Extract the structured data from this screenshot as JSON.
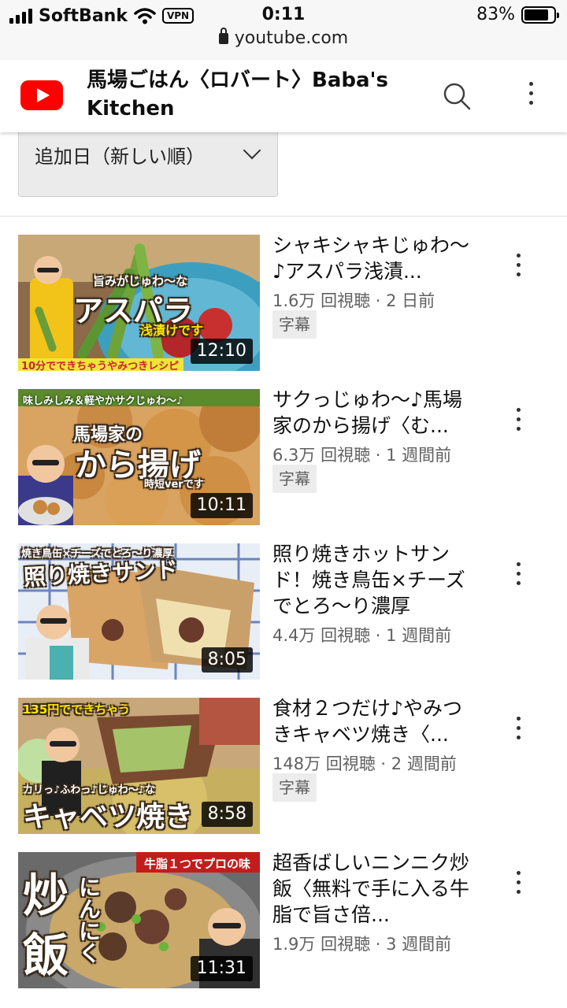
{
  "status_bar": {
    "carrier": "SoftBank",
    "vpn": "VPN",
    "time": "0:11",
    "battery": "83%",
    "battery_level": 0.83,
    "url": "youtube.com"
  },
  "header": {
    "channel_title": "馬場ごはん〈ロバート〉Baba's Kitchen",
    "logo_icon": "youtube-logo-icon",
    "search_icon": "search-icon",
    "menu_icon": "more-vert-icon"
  },
  "sort": {
    "label": "追加日（新しい順）"
  },
  "videos": [
    {
      "title": "シャキシャキじゅわ〜♪アスパラ浅漬...",
      "meta": "1.6万 回視聴 · 2 日前",
      "caption": "字幕",
      "duration": "12:10",
      "thumb": {
        "top": "旨みがじゅわ〜な",
        "main": "アスパラ",
        "sub": "浅漬けです",
        "bottom": "10分でできちゃうやみつきレシピ"
      }
    },
    {
      "title": "サクっじゅわ〜♪馬場家のから揚げ〈む...",
      "meta": "6.3万 回視聴 · 1 週間前",
      "caption": "字幕",
      "duration": "10:11",
      "thumb": {
        "top": "味しみしみ＆軽やかサクじゅわ〜♪",
        "main1": "馬場家の",
        "main2": "から揚げ",
        "sub": "時短verです"
      }
    },
    {
      "title": "照り焼きホットサンド！焼き鳥缶×チーズでとろ〜り濃厚",
      "meta": "4.4万 回視聴 · 1 週間前",
      "caption": "",
      "duration": "8:05",
      "thumb": {
        "top": "焼き鳥缶×チーズでとろ〜り濃厚",
        "main": "照り焼きサンド"
      }
    },
    {
      "title": "食材２つだけ♪やみつきキャベツ焼き〈...",
      "meta": "148万 回視聴 · 2 週間前",
      "caption": "字幕",
      "duration": "8:58",
      "thumb": {
        "top": "135円でできちゃう",
        "mid": "カリっ♪ふわっ♪じゅわ〜♪な",
        "main": "キャベツ焼き"
      }
    },
    {
      "title": "超香ばしいニンニク炒飯〈無料で手に入る牛脂で旨さ倍...",
      "meta": "1.9万 回視聴 · 3 週間前",
      "caption": "",
      "duration": "11:31",
      "thumb": {
        "top": "牛脂１つでプロの味",
        "main1": "炒",
        "main2": "飯",
        "side": "にんにく"
      }
    }
  ]
}
